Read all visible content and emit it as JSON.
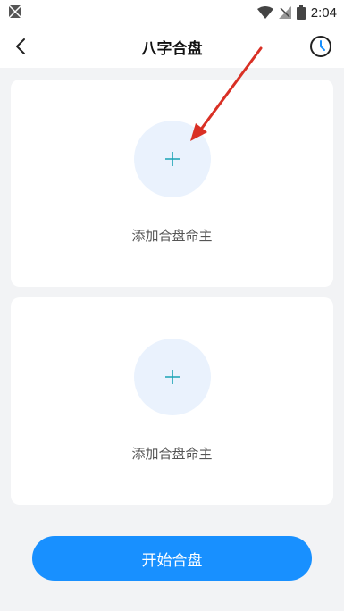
{
  "status_bar": {
    "time": "2:04"
  },
  "header": {
    "title": "八字合盘"
  },
  "cards": [
    {
      "label": "添加合盘命主"
    },
    {
      "label": "添加合盘命主"
    }
  ],
  "start_button": {
    "label": "开始合盘"
  },
  "colors": {
    "accent": "#1890ff",
    "add_bg": "#eaf2fd",
    "annotation_arrow": "#d93025"
  },
  "icons": [
    "back-arrow-icon",
    "history-clock-icon",
    "plus-icon",
    "wifi-icon",
    "signal-icon",
    "battery-icon"
  ]
}
